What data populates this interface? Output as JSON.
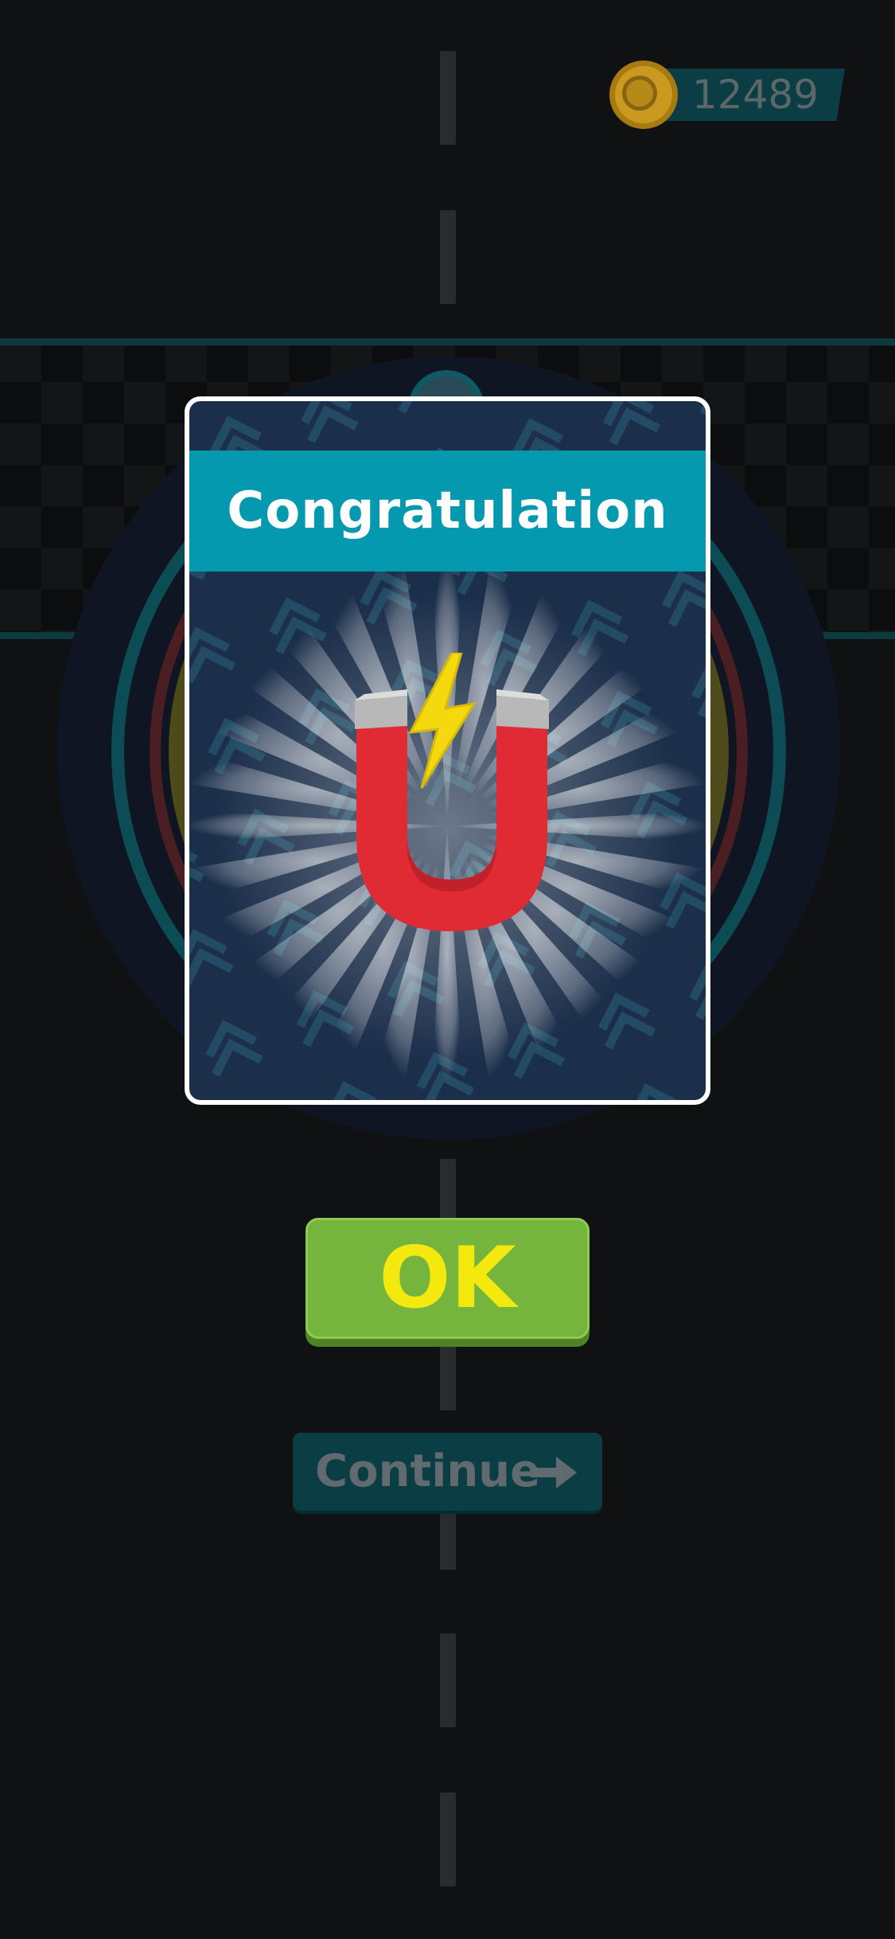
{
  "hud": {
    "coins": "12489",
    "coin_icon": "coin-icon"
  },
  "modal": {
    "title": "Congratulation",
    "reward_icon": "magnet-icon",
    "reward_accent_icon": "lightning-icon"
  },
  "buttons": {
    "ok_label": "OK",
    "continue_label": "Continue",
    "continue_icon": "arrow-right-icon"
  },
  "colors": {
    "banner": "#0599b0",
    "ok_button": "#76b53d",
    "ok_text": "#f4e90e",
    "continue_button": "#0b3e44",
    "magnet_red": "#e02b34"
  }
}
